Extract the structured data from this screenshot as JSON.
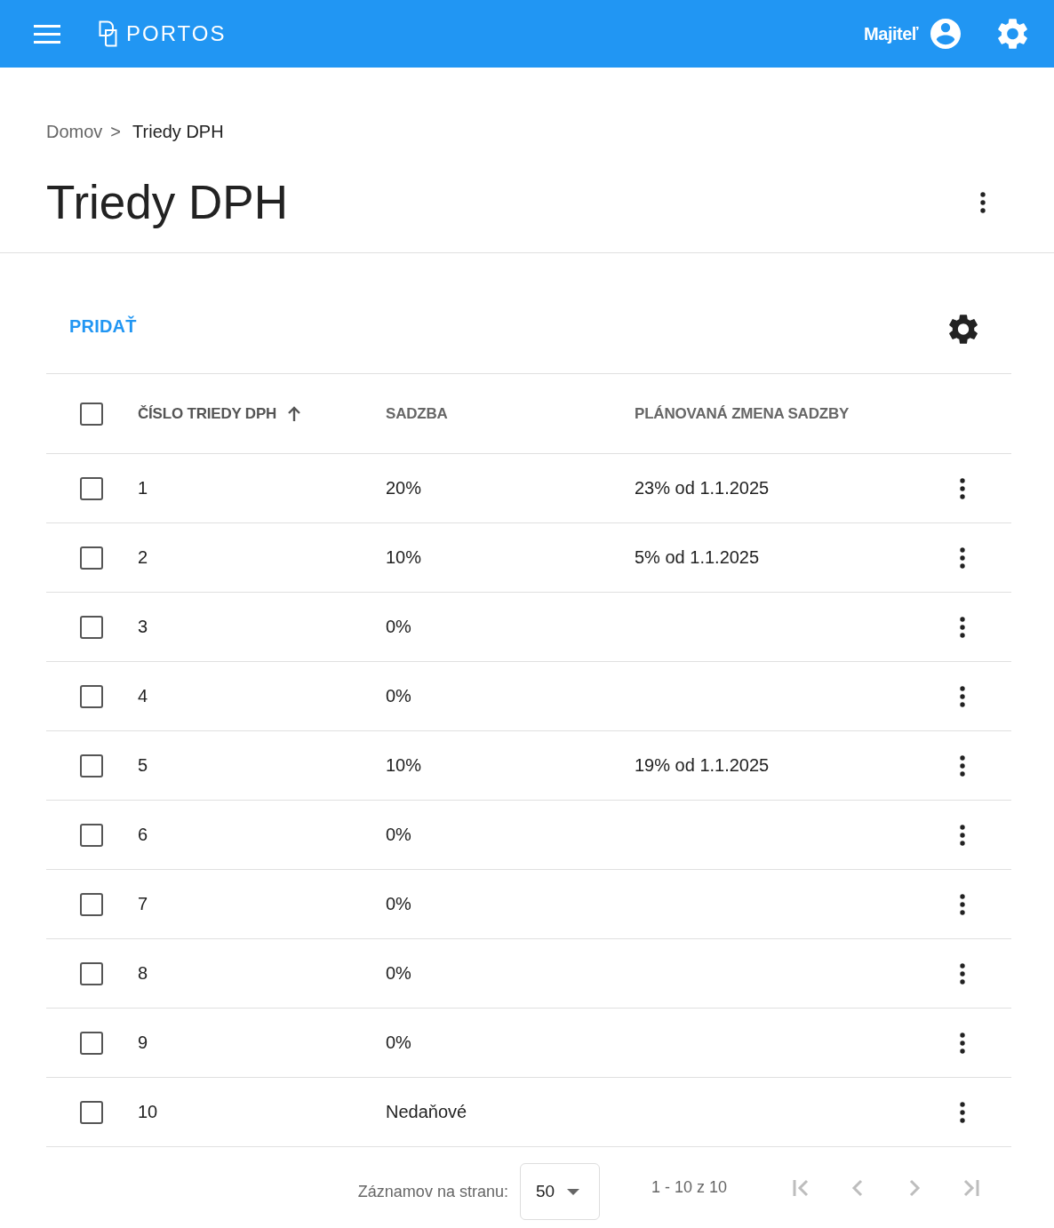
{
  "app_bar": {
    "logo_text": "PORTOS",
    "user": "Majiteľ"
  },
  "breadcrumb": {
    "separator": ">",
    "items": [
      {
        "label": "Domov",
        "current": false
      },
      {
        "label": "Triedy DPH",
        "current": true
      }
    ]
  },
  "page": {
    "title": "Triedy DPH"
  },
  "toolbar": {
    "add_button": "PRIDAŤ"
  },
  "table": {
    "select_all": {
      "checked": false
    },
    "columns": [
      {
        "label": "ČÍSLO TRIEDY DPH",
        "sorted": true
      },
      {
        "label": "SADZBA",
        "sorted": false
      },
      {
        "label": "PLÁNOVANÁ ZMENA SADZBY",
        "sorted": false
      }
    ],
    "rows": [
      {
        "checked": false,
        "class": "1",
        "rate": "20%",
        "planned_change": "23% od 1.1.2025"
      },
      {
        "checked": false,
        "class": "2",
        "rate": "10%",
        "planned_change": "5% od 1.1.2025"
      },
      {
        "checked": false,
        "class": "3",
        "rate": "0%"
      },
      {
        "checked": false,
        "class": "4",
        "rate": "0%"
      },
      {
        "checked": false,
        "class": "5",
        "rate": "10%",
        "planned_change": "19% od 1.1.2025"
      },
      {
        "checked": false,
        "class": "6",
        "rate": "0%"
      },
      {
        "checked": false,
        "class": "7",
        "rate": "0%"
      },
      {
        "checked": false,
        "class": "8",
        "rate": "0%"
      },
      {
        "checked": false,
        "class": "9",
        "rate": "0%"
      },
      {
        "checked": false,
        "class": "10",
        "rate": "Nedaňové"
      }
    ]
  },
  "pagination": {
    "rows_per_page_label": "Záznamov na stranu:",
    "rows_per_page": "50",
    "range": "1 - 10 z 10",
    "buttons": [
      {
        "kind": "first",
        "disabled": true
      },
      {
        "kind": "previous",
        "disabled": true
      },
      {
        "kind": "next",
        "disabled": true
      },
      {
        "kind": "last",
        "disabled": true
      }
    ]
  }
}
